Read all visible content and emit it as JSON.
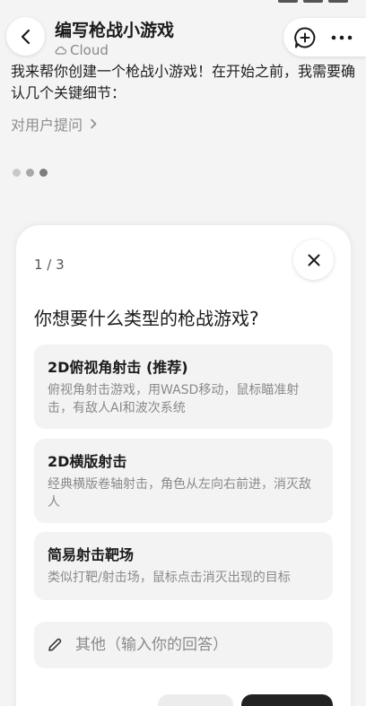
{
  "header": {
    "title": "编写枪战小游戏",
    "subtitle": "Cloud"
  },
  "message": {
    "text": "我来帮你创建一个枪战小游戏！在开始之前，我需要确认几个关键细节：",
    "ask_link": "对用户提问"
  },
  "card": {
    "counter": "1 / 3",
    "question": "你想要什么类型的枪战游戏?",
    "options": [
      {
        "title": "2D俯视角射击 (推荐)",
        "desc": "俯视角射击游戏，用WASD移动，鼠标瞄准射击，有敌人AI和波次系统"
      },
      {
        "title": "2D横版射击",
        "desc": "经典横版卷轴射击，角色从左向右前进，消灭敌人"
      },
      {
        "title": "简易射击靶场",
        "desc": "类似打靶/射击场，鼠标点击消灭出现的目标"
      }
    ],
    "other_placeholder": "其他（输入你的回答）"
  },
  "icons": {
    "back": "chevron-left-icon",
    "cloud": "cloud-icon",
    "new_chat": "chat-plus-icon",
    "more": "more-horizontal-icon",
    "ask_chevron": "chevron-right-icon",
    "close": "close-icon",
    "pencil": "pencil-icon"
  },
  "colors": {
    "background": "#f4f4f4",
    "card": "#ffffff",
    "option_bg": "#f3f3f3",
    "primary_button": "#222222"
  }
}
